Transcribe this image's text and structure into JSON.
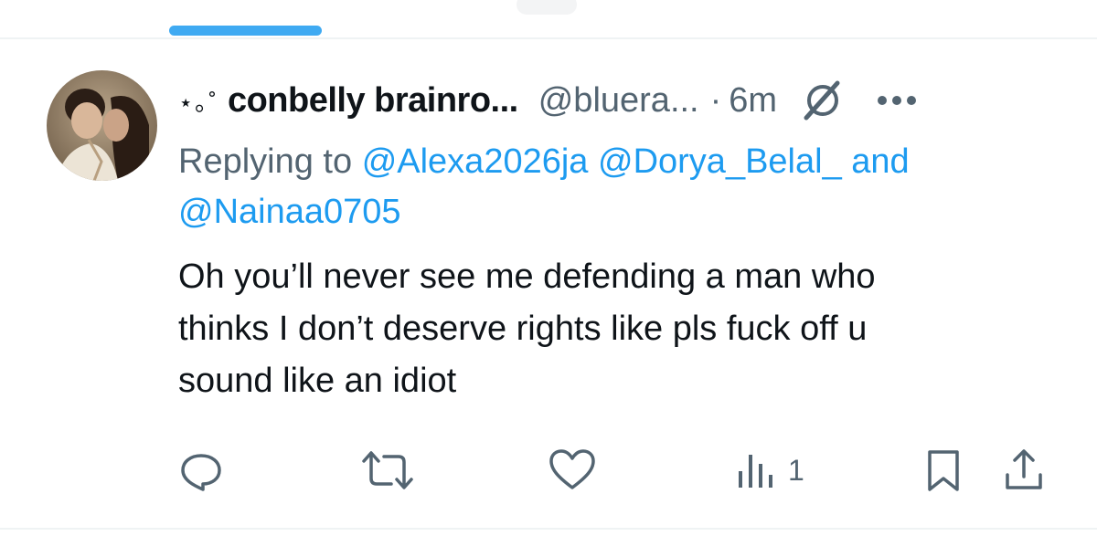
{
  "tweet": {
    "name_decoration": "⋆｡˚",
    "display_name": "conbelly brainro...",
    "handle": "@bluera...",
    "separator": "·",
    "time": "6m",
    "replying_prefix": "Replying to",
    "mentions": [
      "@Alexa2026ja",
      "@Dorya_Belal_",
      "@Nainaa0705"
    ],
    "mention_joiner": "and",
    "text": "Oh you’ll never see me defending a man who\nthinks I don’t deserve rights like pls fuck off u\nsound like an idiot"
  },
  "actions": {
    "views_count": "1"
  },
  "colors": {
    "accent": "#1d9bf0",
    "secondary_text": "#536471",
    "primary_text": "#0f1419"
  },
  "icons": [
    "grok-icon",
    "more-icon",
    "reply-icon",
    "retweet-icon",
    "like-icon",
    "views-icon",
    "bookmark-icon",
    "share-icon"
  ]
}
